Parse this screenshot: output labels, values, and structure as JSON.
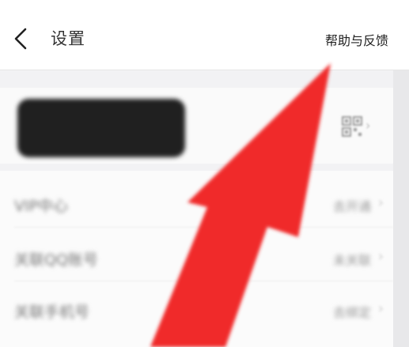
{
  "nav": {
    "title": "设置",
    "help_label": "帮助与反馈"
  },
  "profile": {
    "qr_icon": "qr-code-icon"
  },
  "list": {
    "rows": [
      {
        "label": "VIP中心",
        "value": "去开通"
      },
      {
        "label": "关联QQ账号",
        "value": "未关联"
      },
      {
        "label": "关联手机号",
        "value": "去绑定"
      }
    ]
  },
  "annotation": {
    "arrow_color": "#f02a2a"
  }
}
